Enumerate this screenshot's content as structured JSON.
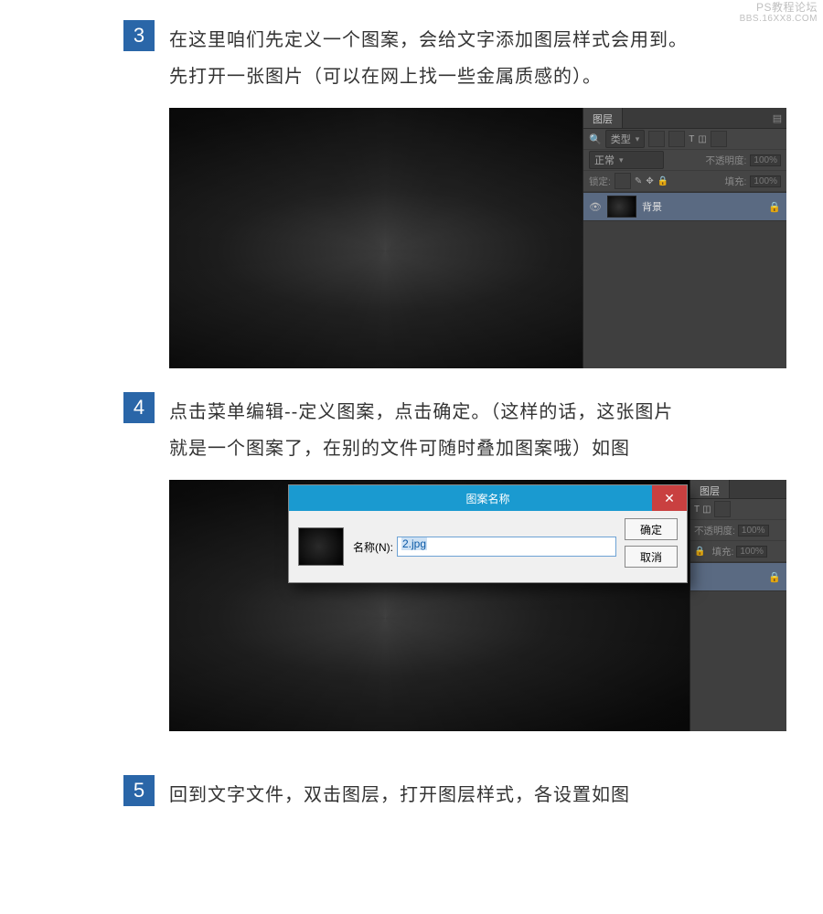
{
  "watermark": {
    "line1": "PS教程论坛",
    "line2": "BBS.16XX8.COM"
  },
  "step3": {
    "num": "3",
    "text": "在这里咱们先定义一个图案，会给文字添加图层样式会用到。先打开一张图片（可以在网上找一些金属质感的）。"
  },
  "step4": {
    "num": "4",
    "text": "点击菜单编辑--定义图案，点击确定。（这样的话，这张图片就是一个图案了，在别的文件可随时叠加图案哦）如图"
  },
  "step5": {
    "num": "5",
    "text": "回到文字文件，双击图层，打开图层样式，各设置如图"
  },
  "psPanel": {
    "tab": "图层",
    "typeLabel": "类型",
    "blend": "正常",
    "opacityLabel": "不透明度:",
    "opacity": "100%",
    "lockLabel": "锁定:",
    "fillLabel": "填充:",
    "fill": "100%",
    "layerName": "背景"
  },
  "dialog": {
    "title": "图案名称",
    "nameLabel": "名称(N):",
    "nameValue": "2.jpg",
    "ok": "确定",
    "cancel": "取消"
  }
}
